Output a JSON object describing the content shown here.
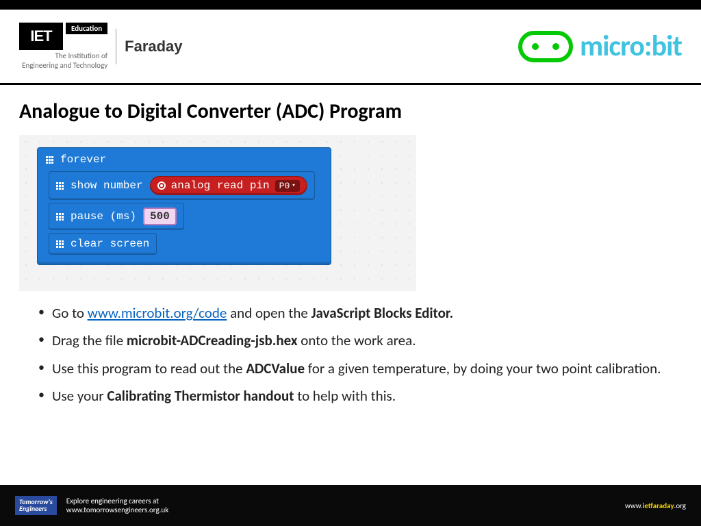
{
  "header": {
    "iet_mark": "IET",
    "iet_edu": "Education",
    "iet_inst1": "The Institution of",
    "iet_inst2": "Engineering and Technology",
    "faraday": "Faraday",
    "microbit": "micro:bit"
  },
  "title": "Analogue to Digital Converter (ADC) Program",
  "blocks": {
    "forever": "forever",
    "show_number": "show number",
    "analog_read": "analog read pin",
    "pin": "P0",
    "pause": "pause (ms)",
    "pause_val": "500",
    "clear": "clear screen"
  },
  "bullets": {
    "b1_pre": "Go to ",
    "b1_link": "www.microbit.org/code",
    "b1_mid": " and open the ",
    "b1_bold": "JavaScript Blocks Editor.",
    "b2_pre": "Drag the file ",
    "b2_bold": "microbit-ADCreading-jsb.hex",
    "b2_post": " onto the work area.",
    "b3_pre": "Use this program to read out the ",
    "b3_bold": "ADCValue",
    "b3_post": " for a given temperature, by doing your two point calibration.",
    "b4_pre": "Use your ",
    "b4_bold": "Calibrating Thermistor handout",
    "b4_post": " to help with this."
  },
  "footer": {
    "te1": "Tomorrow's",
    "te2": "Engineers",
    "explore": "Explore engineering careers at",
    "te_url": "www.tomorrowsengineers.org.uk",
    "url_pre": "www.",
    "url_bold": "ietfaraday",
    "url_post": ".org"
  }
}
